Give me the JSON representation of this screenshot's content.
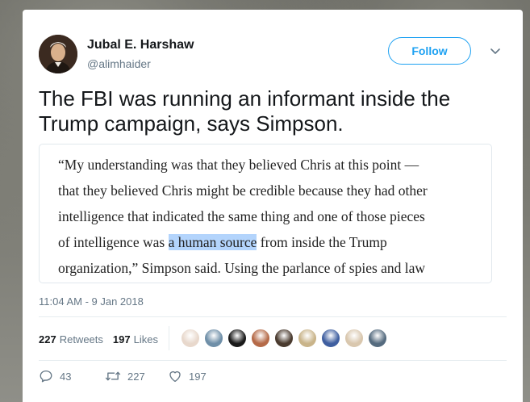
{
  "tweet": {
    "author": {
      "display_name": "Jubal E. Harshaw",
      "handle": "@alimhaider",
      "avatar_icon": "portrait-avatar"
    },
    "follow_label": "Follow",
    "caret_icon": "chevron-down-icon",
    "text_lines": [
      "The FBI was running an informant inside the",
      "Trump campaign, says Simpson."
    ],
    "quote_image": {
      "lines": [
        {
          "pre": "“My understanding was that they believed Chris at this point —",
          "hl": "",
          "post": ""
        },
        {
          "pre": "that they believed Chris might be credible because they had other",
          "hl": "",
          "post": ""
        },
        {
          "pre": "intelligence that indicated the same thing and one of those pieces",
          "hl": "",
          "post": ""
        },
        {
          "pre": "of intelligence was ",
          "hl": "a human source",
          "post": " from inside the Trump"
        },
        {
          "pre": "organization,” Simpson said. Using the parlance of spies and law",
          "hl": "",
          "post": ""
        }
      ],
      "highlight_color": "#b3d4fc"
    },
    "timestamp": "11:04 AM - 9 Jan 2018",
    "stats": {
      "retweets_count": "227",
      "retweets_label": "Retweets",
      "likes_count": "197",
      "likes_label": "Likes"
    },
    "likers": [
      {
        "name": "liker-avatar-1",
        "color": "#e8d8cc"
      },
      {
        "name": "liker-avatar-2",
        "color": "#6f8fa8"
      },
      {
        "name": "liker-avatar-3",
        "color": "#1a1a1a"
      },
      {
        "name": "liker-avatar-4",
        "color": "#b56a48"
      },
      {
        "name": "liker-avatar-5",
        "color": "#4a3b2f"
      },
      {
        "name": "liker-avatar-6",
        "color": "#c9b48a"
      },
      {
        "name": "liker-avatar-7",
        "color": "#3f5fa0"
      },
      {
        "name": "liker-avatar-8",
        "color": "#d9c7ae"
      },
      {
        "name": "liker-avatar-9",
        "color": "#556b7f"
      }
    ],
    "actions": {
      "reply_count": "43",
      "retweet_count": "227",
      "like_count": "197"
    },
    "colors": {
      "accent": "#1da1f2",
      "text": "#14171a",
      "muted": "#657786"
    }
  }
}
